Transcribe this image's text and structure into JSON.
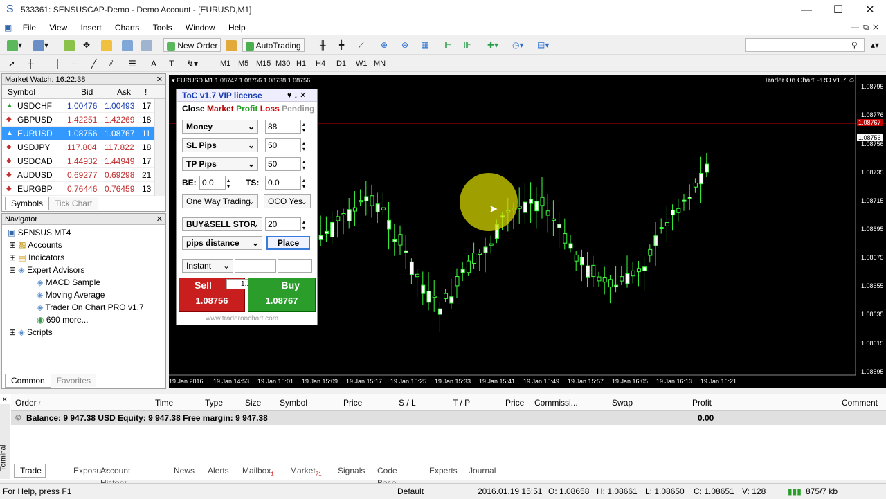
{
  "window": {
    "title": "533361: SENSUSCAP-Demo - Demo Account - [EURUSD,M1]"
  },
  "menu": [
    "File",
    "View",
    "Insert",
    "Charts",
    "Tools",
    "Window",
    "Help"
  ],
  "toolbar": {
    "new_order": "New Order",
    "autotrading": "AutoTrading",
    "timeframes": [
      "M1",
      "M5",
      "M15",
      "M30",
      "H1",
      "H4",
      "D1",
      "W1",
      "MN"
    ]
  },
  "market_watch": {
    "title": "Market Watch: 16:22:38",
    "headers": [
      "Symbol",
      "Bid",
      "Ask",
      "!"
    ],
    "rows": [
      {
        "symbol": "USDCHF",
        "bid": "1.00476",
        "ask": "1.00493",
        "spread": "17"
      },
      {
        "symbol": "GBPUSD",
        "bid": "1.42251",
        "ask": "1.42269",
        "spread": "18"
      },
      {
        "symbol": "EURUSD",
        "bid": "1.08756",
        "ask": "1.08767",
        "spread": "11"
      },
      {
        "symbol": "USDJPY",
        "bid": "117.804",
        "ask": "117.822",
        "spread": "18"
      },
      {
        "symbol": "USDCAD",
        "bid": "1.44932",
        "ask": "1.44949",
        "spread": "17"
      },
      {
        "symbol": "AUDUSD",
        "bid": "0.69277",
        "ask": "0.69298",
        "spread": "21"
      },
      {
        "symbol": "EURGBP",
        "bid": "0.76446",
        "ask": "0.76459",
        "spread": "13"
      }
    ],
    "tabs": [
      "Symbols",
      "Tick Chart"
    ]
  },
  "navigator": {
    "title": "Navigator",
    "root": "SENSUS MT4",
    "items": [
      "Accounts",
      "Indicators",
      "Expert Advisors",
      "MACD Sample",
      "Moving Average",
      "Trader On Chart PRO v1.7",
      "690 more...",
      "Scripts"
    ],
    "tabs": [
      "Common",
      "Favorites"
    ]
  },
  "chart": {
    "header": "EURUSD,M1  1.08742 1.08756 1.08738 1.08756",
    "ea_label": "Trader On Chart PRO v1.7",
    "y_ticks": [
      "1.08795",
      "1.08776",
      "1.08756",
      "1.08735",
      "1.08715",
      "1.08695",
      "1.08675",
      "1.08655",
      "1.08635",
      "1.08615",
      "1.08595"
    ],
    "x_ticks": [
      "19 Jan 2016",
      "19 Jan 14:53",
      "19 Jan 15:01",
      "19 Jan 15:09",
      "19 Jan 15:17",
      "19 Jan 15:25",
      "19 Jan 15:33",
      "19 Jan 15:41",
      "19 Jan 15:49",
      "19 Jan 15:57",
      "19 Jan 16:05",
      "19 Jan 16:13",
      "19 Jan 16:21"
    ],
    "ask_label": "1.08767",
    "bid_label": "1.08756"
  },
  "toc": {
    "title": "ToC v1.7 VIP license",
    "close": "Close",
    "market": "Market",
    "profit": "Profit",
    "loss": "Loss",
    "pending": "Pending",
    "money_label": "Money",
    "money_val": "88",
    "sl_label": "SL Pips",
    "sl_val": "50",
    "tp_label": "TP Pips",
    "tp_val": "50",
    "be_label": "BE:",
    "be_val": "0.0",
    "ts_label": "TS:",
    "ts_val": "0.0",
    "mode": "One Way Trading",
    "oco": "OCO Yes",
    "order_type": "BUY&SELL STOP",
    "order_val": "20",
    "dist": "pips distance",
    "place": "Place",
    "exec": "Instant",
    "sell": "Sell",
    "buy": "Buy",
    "lot": "1.1",
    "sell_price": "1.08756",
    "buy_price": "1.08767",
    "site": "www.traderonchart.com"
  },
  "terminal": {
    "headers": [
      "Order",
      "Time",
      "Type",
      "Size",
      "Symbol",
      "Price",
      "S / L",
      "T / P",
      "Price",
      "Commissi...",
      "Swap",
      "Profit",
      "Comment"
    ],
    "balance": "Balance: 9 947.38 USD  Equity: 9 947.38  Free margin: 9 947.38",
    "profit": "0.00",
    "tabs": [
      "Trade",
      "Exposure",
      "Account History",
      "News",
      "Alerts",
      "Mailbox",
      "Market",
      "Signals",
      "Code Base",
      "Experts",
      "Journal"
    ],
    "mailbox_count": "1",
    "market_count": "71",
    "side_label": "Terminal"
  },
  "status": {
    "help": "For Help, press F1",
    "profile": "Default",
    "time": "2016.01.19 15:51",
    "o": "O: 1.08658",
    "h": "H: 1.08661",
    "l": "L: 1.08650",
    "c": "C: 1.08651",
    "v": "V: 128",
    "traffic": "875/7 kb"
  }
}
